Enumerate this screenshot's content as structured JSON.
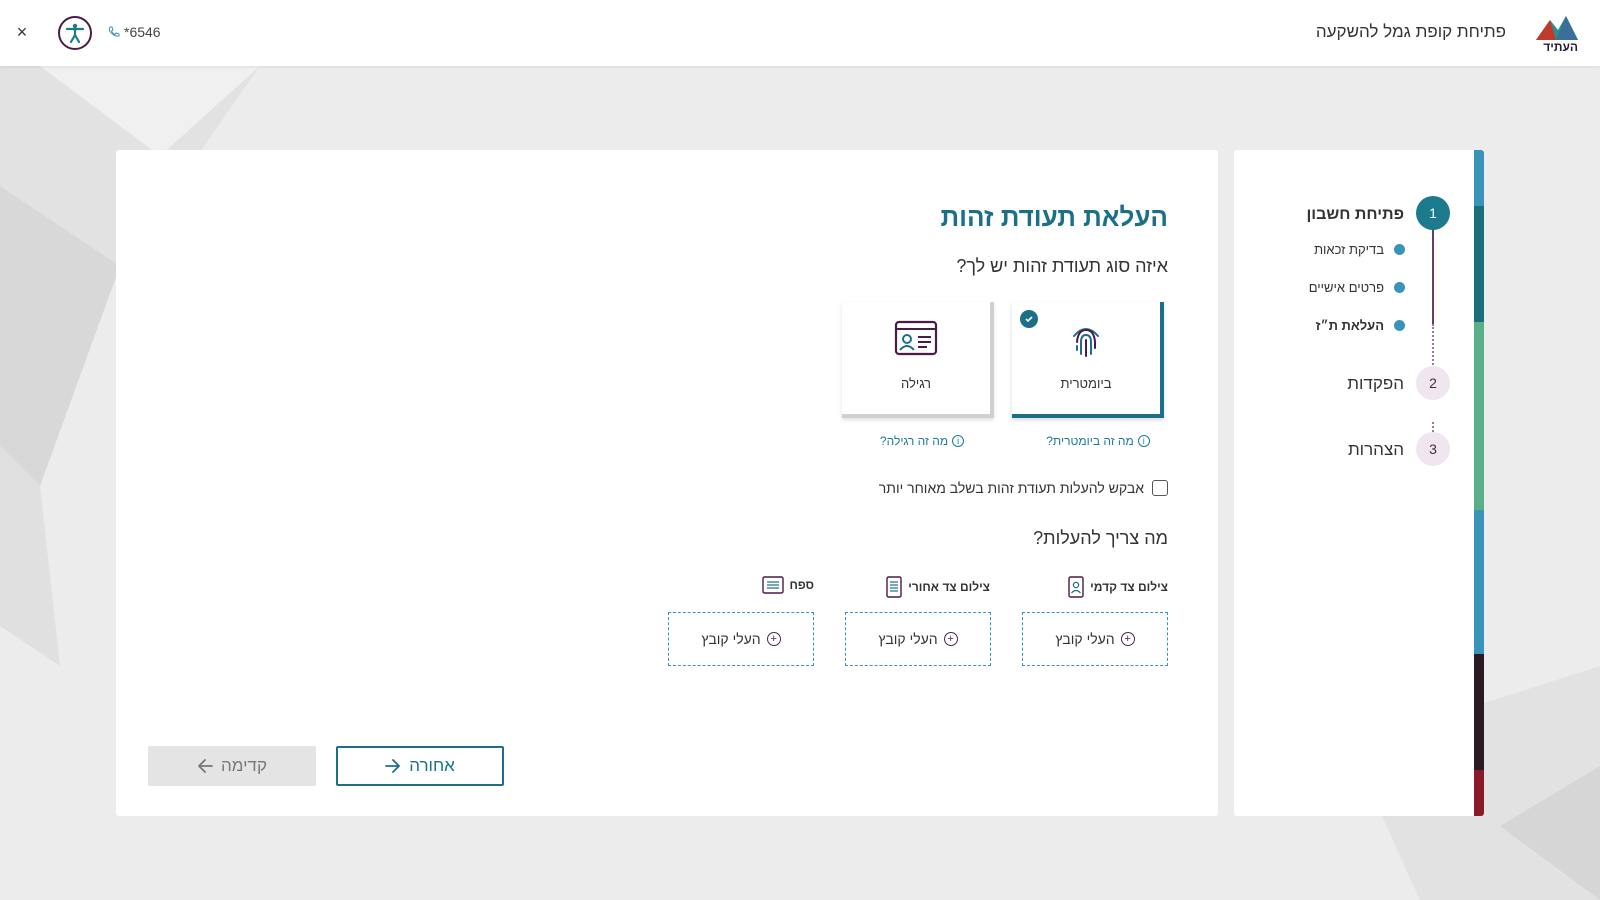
{
  "header": {
    "title": "פתיחת קופת גמל להשקעה",
    "logo_text": "העתיד",
    "phone": "*6546",
    "close_label": "×"
  },
  "colors": {
    "primary": "#1b6f86",
    "accent_purple": "#4a1a4a",
    "link": "#1b7a9c",
    "stripe": [
      "#3a93b8",
      "#1b6f7a",
      "#5aaf8a",
      "#3a93b8",
      "#2b1a24",
      "#8a1a2a"
    ]
  },
  "stepper": {
    "steps": [
      {
        "number": "1",
        "label": "פתיחת חשבון",
        "state": "active"
      },
      {
        "number": "2",
        "label": "הפקדות",
        "state": "pending"
      },
      {
        "number": "3",
        "label": "הצהרות",
        "state": "pending"
      }
    ],
    "sub_steps": [
      {
        "label": "בדיקת זכאות",
        "state": "done"
      },
      {
        "label": "פרטים אישיים",
        "state": "done"
      },
      {
        "label": "העלאת ת״ז",
        "state": "current"
      }
    ]
  },
  "main": {
    "title": "העלאת תעודת זהות",
    "question": "איזה סוג תעודת זהות יש לך?",
    "id_types": [
      {
        "label": "ביומטרית",
        "selected": true,
        "icon": "fingerprint-icon",
        "info": "מה זה ביומטרית?"
      },
      {
        "label": "רגילה",
        "selected": false,
        "icon": "id-card-icon",
        "info": "מה זה רגילה?"
      }
    ],
    "later_label": "אבקש להעלות תעודת זהות בשלב מאוחר יותר",
    "upload_question": "מה צריך להעלות?",
    "uploads": [
      {
        "label": "צילום צד קדמי",
        "icon": "id-front-icon",
        "button": "העלי קובץ"
      },
      {
        "label": "צילום צד אחורי",
        "icon": "id-back-icon",
        "button": "העלי קובץ"
      },
      {
        "label": "ספח",
        "icon": "appendix-icon",
        "button": "העלי קובץ"
      }
    ],
    "back_button": "אחורה",
    "next_button": "קדימה"
  }
}
